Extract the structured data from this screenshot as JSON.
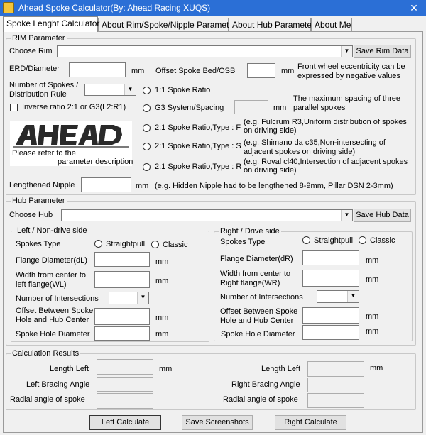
{
  "window": {
    "title": "Ahead Spoke Calculator(By: Ahead Racing XUQS)",
    "minimize_glyph": "—",
    "close_glyph": "✕"
  },
  "tabs": [
    {
      "label": "Spoke Lenght Calculator"
    },
    {
      "label": "About Rim/Spoke/Nipple Parameter"
    },
    {
      "label": "About Hub Parameter"
    },
    {
      "label": "About Me"
    }
  ],
  "rim": {
    "group_title": "RIM Parameter",
    "choose_rim_label": "Choose Rim",
    "choose_rim_value": "",
    "save_rim_button": "Save Rim Data",
    "erd_label": "ERD/Diameter",
    "erd_value": "",
    "erd_unit": "mm",
    "offset_bed_label": "Offset Spoke Bed/OSB",
    "offset_bed_value": "",
    "offset_bed_unit": "mm",
    "eccentricity_note_1": "Front wheel eccentricity can be",
    "eccentricity_note_2": "expressed by negative values",
    "spokes_label_1": "Number of Spokes /",
    "spokes_label_2": "Distribution Rule",
    "spokes_value": "",
    "ratio_1_1": "1:1 Spoke Ratio",
    "inverse_ratio_label": "Inverse ratio 2:1 or G3(L2:R1)",
    "g3_label": "G3 System/Spacing",
    "g3_value": "",
    "g3_unit": "mm",
    "g3_note_1": "The maximum spacing of three",
    "g3_note_2": "parallel spokes",
    "logo_text": "AHEAD",
    "logo_caption_1": "Please refer to the",
    "logo_caption_2": "parameter description",
    "ratio_f": "2:1 Spoke Ratio,Type : F",
    "ratio_f_note_1": "(e.g. Fulcrum R3,Uniform distribution of spokes",
    "ratio_f_note_2": "on driving side)",
    "ratio_s": "2:1 Spoke Ratio,Type : S",
    "ratio_s_note_1": "(e.g. Shimano da c35,Non-intersecting of",
    "ratio_s_note_2": "adjacent spokes on driving side)",
    "ratio_r": "2:1 Spoke Ratio,Type : R",
    "ratio_r_note_1": "(e.g. Roval cl40,Intersection of adjacent spokes",
    "ratio_r_note_2": "on driving side)",
    "nipple_label": "Lengthened Nipple",
    "nipple_value": "",
    "nipple_unit": "mm",
    "nipple_note": "(e.g. Hidden Nipple had to be lengthened 8-9mm, Pillar DSN 2-3mm)"
  },
  "hub": {
    "group_title": "Hub Parameter",
    "choose_hub_label": "Choose Hub",
    "choose_hub_value": "",
    "save_hub_button": "Save Hub Data",
    "left": {
      "title": "Left / Non-drive side",
      "spokes_type_label": "Spokes Type",
      "straightpull": "Straightpull",
      "classic": "Classic",
      "flange_label": "Flange Diameter(dL)",
      "flange_value": "",
      "width_label_1": "Width from center to",
      "width_label_2": "left flange(WL)",
      "width_value": "",
      "intersections_label": "Number of Intersections",
      "intersections_value": "",
      "offset_label_1": "Offset Between Spoke",
      "offset_label_2": "Hole and Hub Center",
      "offset_value": "",
      "hole_label": "Spoke Hole Diameter",
      "hole_value": "",
      "unit": "mm"
    },
    "right": {
      "title": "Right / Drive side",
      "spokes_type_label": "Spokes Type",
      "straightpull": "Straightpull",
      "classic": "Classic",
      "flange_label": "Flange Diameter(dR)",
      "flange_value": "",
      "width_label_1": "Width from center to",
      "width_label_2": "Right flange(WR)",
      "width_value": "",
      "intersections_label": "Number of Intersections",
      "intersections_value": "",
      "offset_label_1": "Offset Between Spoke",
      "offset_label_2": "Hole and Hub Center",
      "offset_value": "",
      "hole_label": "Spoke Hole Diameter",
      "hole_value": "",
      "unit": "mm"
    }
  },
  "results": {
    "group_title": "Calculation Results",
    "length_left_label": "Length Left",
    "length_left_value": "",
    "length_left_unit": "mm",
    "left_bracing_label": "Left Bracing Angle",
    "left_bracing_value": "",
    "radial_left_label": "Radial angle of spoke",
    "radial_left_value": "",
    "length_right_label": "Length Left",
    "length_right_value": "",
    "length_right_unit": "mm",
    "right_bracing_label": "Right Bracing Angle",
    "right_bracing_value": "",
    "radial_right_label": "Radial angle of spoke",
    "radial_right_value": ""
  },
  "actions": {
    "left_calculate": "Left Calculate",
    "save_screenshots": "Save Screenshots",
    "right_calculate": "Right Calculate"
  }
}
